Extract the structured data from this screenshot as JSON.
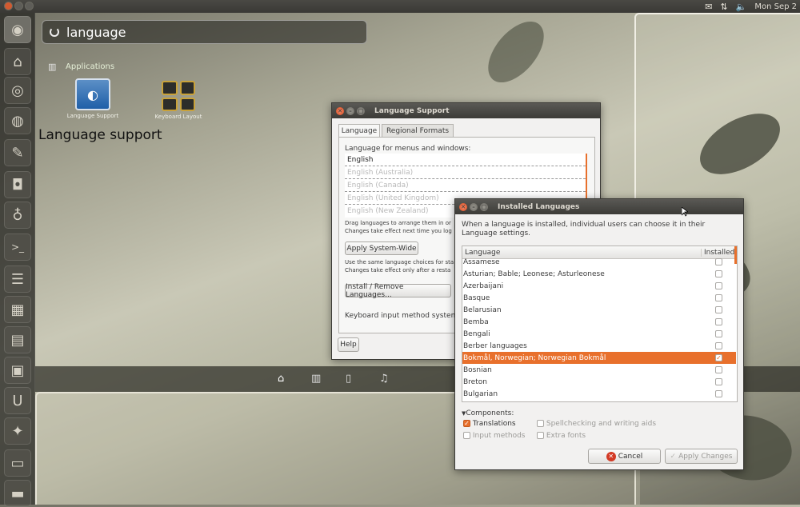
{
  "top_panel": {
    "clock": "Mon Sep 2"
  },
  "dash": {
    "search_value": "language",
    "category": "Applications",
    "apps": [
      {
        "label": "Language Support"
      },
      {
        "label": "Keyboard Layout"
      }
    ],
    "tooltip": "Language support"
  },
  "language_support": {
    "title": "Language Support",
    "tabs": [
      "Language",
      "Regional Formats"
    ],
    "menus_label": "Language for menus and windows:",
    "languages": [
      "English",
      "English (Australia)",
      "English (Canada)",
      "English (United Kingdom)",
      "English (New Zealand)"
    ],
    "drag_hint_1": "Drag languages to arrange them in or",
    "drag_hint_2": "Changes take effect next time you log",
    "apply_button": "Apply System-Wide",
    "same_hint_1": "Use the same language choices for sta",
    "same_hint_2": "Changes take effect only after a resta",
    "install_button": "Install / Remove Languages...",
    "keyboard_label": "Keyboard input method system",
    "help_button": "Help"
  },
  "installed_languages": {
    "title": "Installed Languages",
    "description": "When a language is installed, individual users can choose it in their Language settings.",
    "col_language": "Language",
    "col_installed": "Installed",
    "rows": [
      {
        "name": "Assamese",
        "installed": false
      },
      {
        "name": "Asturian; Bable; Leonese; Asturleonese",
        "installed": false
      },
      {
        "name": "Azerbaijani",
        "installed": false
      },
      {
        "name": "Basque",
        "installed": false
      },
      {
        "name": "Belarusian",
        "installed": false
      },
      {
        "name": "Bemba",
        "installed": false
      },
      {
        "name": "Bengali",
        "installed": false
      },
      {
        "name": "Berber languages",
        "installed": false
      },
      {
        "name": "Bokmål, Norwegian; Norwegian Bokmål",
        "installed": true
      },
      {
        "name": "Bosnian",
        "installed": false
      },
      {
        "name": "Breton",
        "installed": false
      },
      {
        "name": "Bulgarian",
        "installed": false
      }
    ],
    "components_label": "Components:",
    "translations": "Translations",
    "input_methods": "Input methods",
    "spellchecking": "Spellchecking and writing aids",
    "extra_fonts": "Extra fonts",
    "cancel_button": "Cancel",
    "apply_button": "Apply Changes"
  },
  "colors": {
    "accent": "#e8702c",
    "titlebar": "#3c3b37"
  }
}
